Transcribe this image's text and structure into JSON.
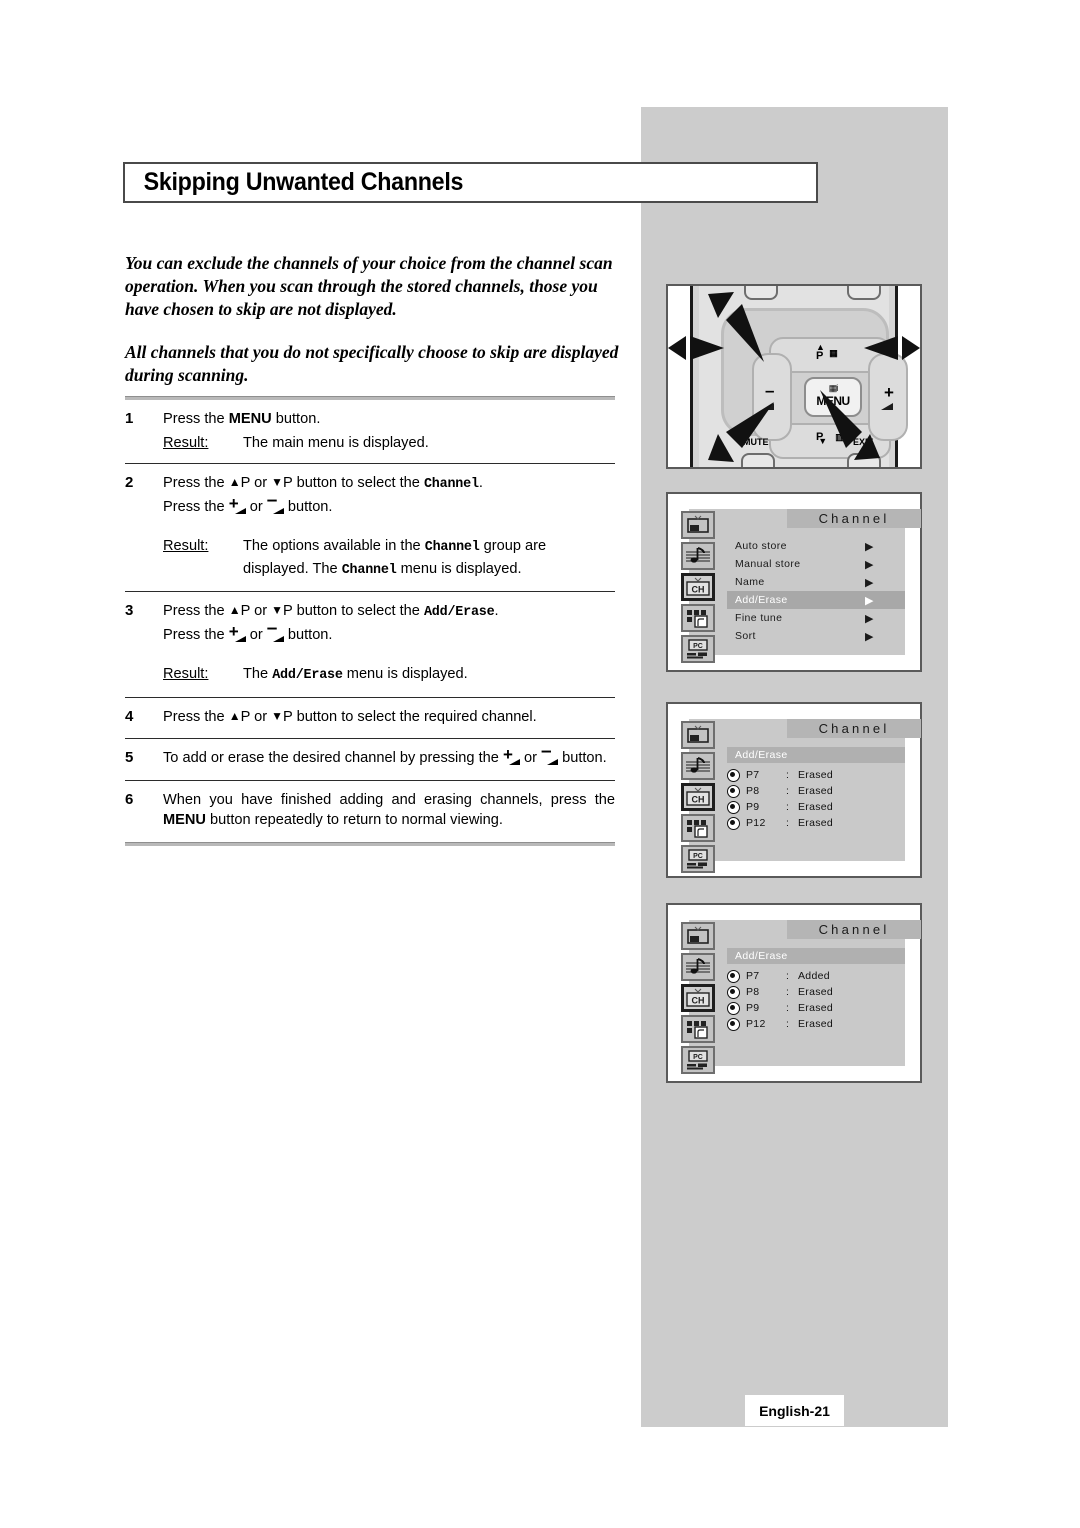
{
  "page": {
    "title": "Skipping Unwanted Channels",
    "footer_label": "English-21"
  },
  "intro": {
    "paragraph1": "You can exclude the channels of your choice from the channel scan operation. When you scan through the stored channels, those you have chosen to skip are not displayed.",
    "paragraph2": "All channels that you do not specifically choose to skip are displayed during scanning."
  },
  "steps": {
    "result_label": "Result:",
    "items": [
      {
        "num": "1",
        "line1_pre": "Press the ",
        "line1_bold": "MENU",
        "line1_post": " button.",
        "result": "The main menu is displayed."
      },
      {
        "num": "2",
        "line1_pre": "Press the ",
        "line1_mid": "P or ",
        "line1_mid2": "P button to select the ",
        "line1_code": "Channel",
        "line1_post": ".",
        "line2_pre": "Press the ",
        "line2_mid": " or ",
        "line2_post": " button.",
        "result_a": "The options available in the ",
        "result_code": "Channel",
        "result_b": " group are displayed. The ",
        "result_code2": "Channel",
        "result_c": " menu is displayed."
      },
      {
        "num": "3",
        "line1_pre": "Press the ",
        "line1_mid": "P or ",
        "line1_mid2": "P button to select the ",
        "line1_code": "Add/Erase",
        "line1_post": ".",
        "line2_pre": "Press the ",
        "line2_mid": " or ",
        "line2_post": " button.",
        "result_a": "The ",
        "result_code": "Add/Erase",
        "result_b": " menu is displayed."
      },
      {
        "num": "4",
        "line1_pre": "Press the ",
        "line1_mid": "P or ",
        "line1_mid2": "P button to select the required channel."
      },
      {
        "num": "5",
        "line1_pre": "To add or erase the desired channel by pressing the ",
        "line1_mid": " or ",
        "line1_post": " button."
      },
      {
        "num": "6",
        "line1_pre": "When you have finished adding and erasing channels, press the ",
        "line1_bold": "MENU",
        "line1_post": " button repeatedly to return to normal viewing."
      }
    ]
  },
  "remote": {
    "menu_label": "MENU",
    "p_up_label": "P",
    "p_down_label": "P",
    "plus_label": "+",
    "minus_label": "–",
    "exit_label": "EXIT",
    "mute_label": "MUTE"
  },
  "osd": {
    "icons": [
      "picture-icon",
      "sound-icon",
      "channel-icon",
      "setup-icon",
      "pc-icon"
    ],
    "menu1": {
      "title": "Channel",
      "rows": [
        {
          "name": "Auto store",
          "arrow": "▶",
          "highlight": false
        },
        {
          "name": "Manual store",
          "arrow": "▶",
          "highlight": false
        },
        {
          "name": "Name",
          "arrow": "▶",
          "highlight": false
        },
        {
          "name": "Add/Erase",
          "arrow": "▶",
          "highlight": true
        },
        {
          "name": "Fine tune",
          "arrow": "▶",
          "highlight": false
        },
        {
          "name": "Sort",
          "arrow": "▶",
          "highlight": false
        }
      ]
    },
    "menu2": {
      "title": "Channel",
      "band": "Add/Erase",
      "channels": [
        {
          "prog": "P7",
          "colon": ":",
          "state": "Erased"
        },
        {
          "prog": "P8",
          "colon": ":",
          "state": "Erased"
        },
        {
          "prog": "P9",
          "colon": ":",
          "state": "Erased"
        },
        {
          "prog": "P12",
          "colon": ":",
          "state": "Erased"
        }
      ]
    },
    "menu3": {
      "title": "Channel",
      "band": "Add/Erase",
      "channels": [
        {
          "prog": "P7",
          "colon": ":",
          "state": "Added"
        },
        {
          "prog": "P8",
          "colon": ":",
          "state": "Erased"
        },
        {
          "prog": "P9",
          "colon": ":",
          "state": "Erased"
        },
        {
          "prog": "P12",
          "colon": ":",
          "state": "Erased"
        }
      ]
    }
  },
  "colors": {
    "panel_grey": "#cccccc",
    "osd_bg": "#c9c9c9",
    "osd_highlight": "#a8a8a8",
    "rule": "#b9b9b9"
  }
}
